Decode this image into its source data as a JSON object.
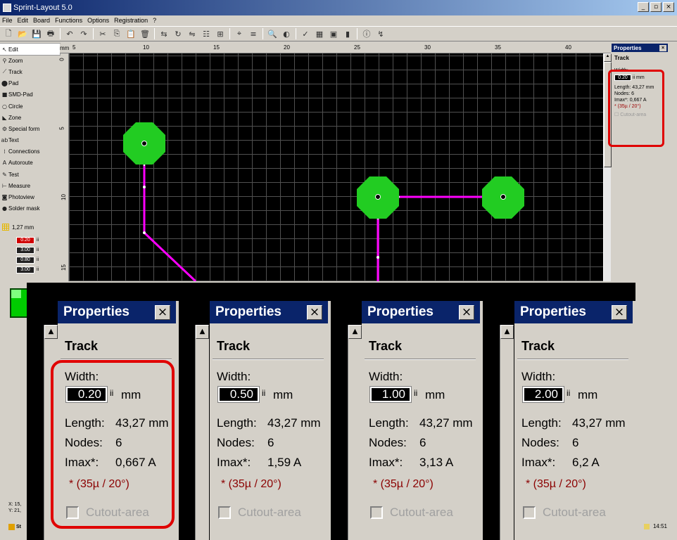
{
  "window": {
    "title": "Sprint-Layout 5.0",
    "buttons": [
      "_",
      "▫",
      "×"
    ]
  },
  "menu": [
    "File",
    "Edit",
    "Board",
    "Functions",
    "Options",
    "Registration",
    "?"
  ],
  "toolbar": [
    "new-icon",
    "open-icon",
    "save-icon",
    "print-icon",
    "|",
    "undo-icon",
    "redo-icon",
    "|",
    "cut-icon",
    "copy-icon",
    "paste-icon",
    "delete-icon",
    "|",
    "swap-icon",
    "rotate-icon",
    "mirror-icon",
    "align-icon",
    "group-icon",
    "|",
    "scan-icon",
    "layer-icon",
    "|",
    "zoom-icon",
    "contrast-icon",
    "|",
    "drc-icon",
    "board-icon",
    "macro-icon",
    "net-icon",
    "|",
    "info-icon",
    "connect-icon"
  ],
  "sidebar": {
    "items": [
      {
        "label": "Edit",
        "icon": "cursor-icon"
      },
      {
        "label": "Zoom",
        "icon": "magnifier-icon"
      },
      {
        "label": "Track",
        "icon": "track-icon"
      },
      {
        "label": "Pad",
        "icon": "pad-icon"
      },
      {
        "label": "SMD-Pad",
        "icon": "smd-pad-icon"
      },
      {
        "label": "Circle",
        "icon": "circle-icon"
      },
      {
        "label": "Zone",
        "icon": "zone-icon"
      },
      {
        "label": "Special form",
        "icon": "special-form-icon"
      },
      {
        "label": "Text",
        "icon": "text-icon"
      },
      {
        "label": "Connections",
        "icon": "connections-icon"
      },
      {
        "label": "Autoroute",
        "icon": "autoroute-icon"
      },
      {
        "label": "Test",
        "icon": "test-icon"
      },
      {
        "label": "Measure",
        "icon": "measure-icon"
      },
      {
        "label": "Photoview",
        "icon": "photoview-icon"
      },
      {
        "label": "Solder mask",
        "icon": "solder-mask-icon"
      }
    ],
    "grid": "1,27 mm",
    "track_width": "0.20",
    "pad_outer": "3.00",
    "pad_inner": "0.80",
    "smd_size": "3.00",
    "unit_mark": "ii"
  },
  "ruler": {
    "unit": "mm",
    "top_ticks": [
      "5",
      "10",
      "15",
      "20",
      "25",
      "30",
      "35",
      "40"
    ],
    "left_ticks": [
      "0",
      "5",
      "10",
      "15"
    ]
  },
  "properties_small": {
    "title": "Properties",
    "close": "×",
    "heading": "Track",
    "width_label": "Width:",
    "width_value": "0.20",
    "width_unit": "ii mm",
    "length": "Length:  43,27 mm",
    "nodes": "Nodes:   6",
    "imax": "Imax*:   0,667 A",
    "note": "* (35µ / 20°)",
    "cutout": "Cutout-area"
  },
  "panels": [
    {
      "title": "Properties",
      "heading": "Track",
      "width_label": "Width:",
      "width_value": "0.20",
      "spin": "ii",
      "unit": "mm",
      "length_label": "Length:",
      "length_value": "43,27 mm",
      "nodes_label": "Nodes:",
      "nodes_value": "6",
      "imax_label": "Imax*:",
      "imax_value": "0,667 A",
      "note": "* (35µ / 20°)",
      "cutout": "Cutout-area"
    },
    {
      "title": "Properties",
      "heading": "Track",
      "width_label": "Width:",
      "width_value": "0.50",
      "spin": "ii",
      "unit": "mm",
      "length_label": "Length:",
      "length_value": "43,27 mm",
      "nodes_label": "Nodes:",
      "nodes_value": "6",
      "imax_label": "Imax*:",
      "imax_value": "1,59 A",
      "note": "* (35µ / 20°)",
      "cutout": "Cutout-area"
    },
    {
      "title": "Properties",
      "heading": "Track",
      "width_label": "Width:",
      "width_value": "1.00",
      "spin": "ii",
      "unit": "mm",
      "length_label": "Length:",
      "length_value": "43,27 mm",
      "nodes_label": "Nodes:",
      "nodes_value": "6",
      "imax_label": "Imax*:",
      "imax_value": "3,13 A",
      "note": "* (35µ / 20°)",
      "cutout": "Cutout-area"
    },
    {
      "title": "Properties",
      "heading": "Track",
      "width_label": "Width:",
      "width_value": "2.00",
      "spin": "ii",
      "unit": "mm",
      "length_label": "Length:",
      "length_value": "43,27 mm",
      "nodes_label": "Nodes:",
      "nodes_value": "6",
      "imax_label": "Imax*:",
      "imax_value": "6,2 A",
      "note": "* (35µ / 20°)",
      "cutout": "Cutout-area"
    }
  ],
  "status": {
    "x": "X: 15,",
    "y": "Y: 21,",
    "start": "St",
    "clock": "14:51"
  },
  "colors": {
    "pad": "#22cc22",
    "track": "#ff00ff",
    "highlight": "#e00000",
    "title_bar": "#0a246a"
  }
}
